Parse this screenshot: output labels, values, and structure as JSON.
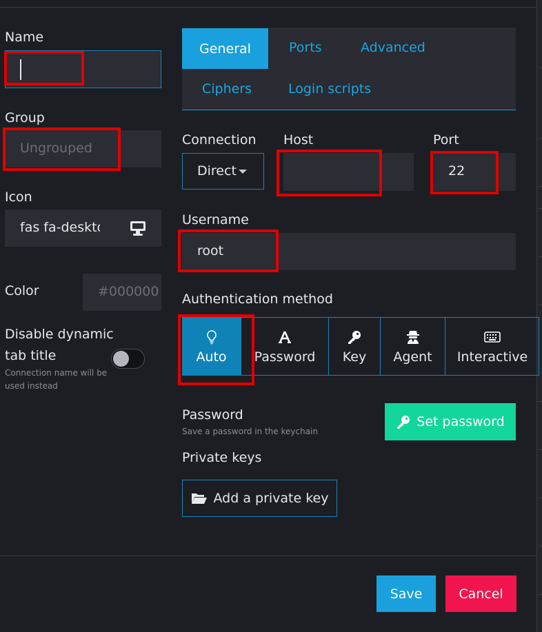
{
  "form": {
    "name_label": "Name",
    "name_value": "",
    "group_label": "Group",
    "group_placeholder": "Ungrouped",
    "icon_label": "Icon",
    "icon_value": "fas fa-desktop",
    "color_label": "Color",
    "color_placeholder": "#000000",
    "disable_title_label_line1": "Disable dynamic",
    "disable_title_label_line2": "tab title",
    "disable_title_hint_line1": "Connection name will be",
    "disable_title_hint_line2": "used instead",
    "disable_title_enabled": false
  },
  "tabs": {
    "general": "General",
    "ports": "Ports",
    "advanced": "Advanced",
    "ciphers": "Ciphers",
    "login_scripts": "Login scripts",
    "active": "General"
  },
  "connection": {
    "connection_label": "Connection",
    "connection_value": "Direct",
    "host_label": "Host",
    "host_value": "",
    "port_label": "Port",
    "port_value": "22",
    "username_label": "Username",
    "username_value": "root"
  },
  "auth": {
    "label": "Authentication method",
    "methods": [
      "Auto",
      "Password",
      "Key",
      "Agent",
      "Interactive"
    ],
    "selected": "Auto",
    "password_label": "Password",
    "password_hint": "Save a password in the keychain",
    "set_password_button": "Set password",
    "private_keys_label": "Private keys",
    "add_key_button": "Add a private key"
  },
  "footer": {
    "save": "Save",
    "cancel": "Cancel"
  },
  "colors": {
    "accent": "#1aa0dc",
    "success": "#13d69c",
    "danger": "#f0154e",
    "highlight": "#e00000"
  }
}
